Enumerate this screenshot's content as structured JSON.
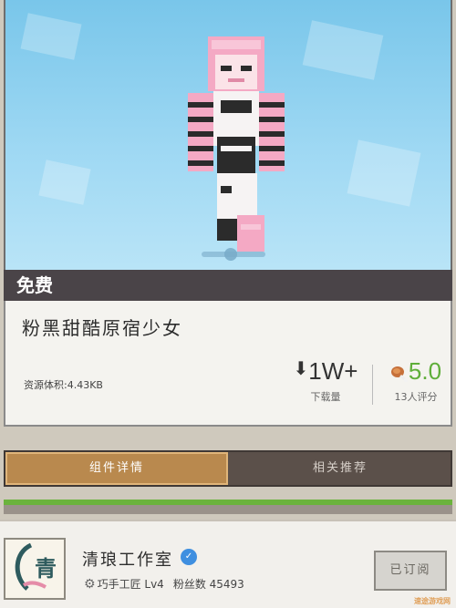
{
  "free_label": "免费",
  "skin": {
    "title": "粉黑甜酷原宿少女",
    "size_text": "资源体积:4.43KB"
  },
  "stats": {
    "downloads_value": "1W+",
    "downloads_label": "下载量",
    "rating_value": "5.0",
    "rating_label": "13人评分"
  },
  "tabs": {
    "detail_label": "组件详情",
    "related_label": "相关推荐"
  },
  "author": {
    "avatar_char": "青",
    "name": "清琅工作室",
    "level_text": "巧手工匠 Lv4",
    "fans_text": "粉丝数 45493",
    "subscribe_label": "已订阅"
  },
  "watermark": "速途游戏网",
  "colors": {
    "sky": "#79c6ea",
    "banner": "#4a4448",
    "tab_active": "#b9894e",
    "rating_green": "#5fae3a",
    "verified_blue": "#3f8fe0"
  },
  "icons": [
    "download-arrow-icon",
    "drumstick-icon",
    "verified-badge-icon",
    "gear-icon"
  ]
}
